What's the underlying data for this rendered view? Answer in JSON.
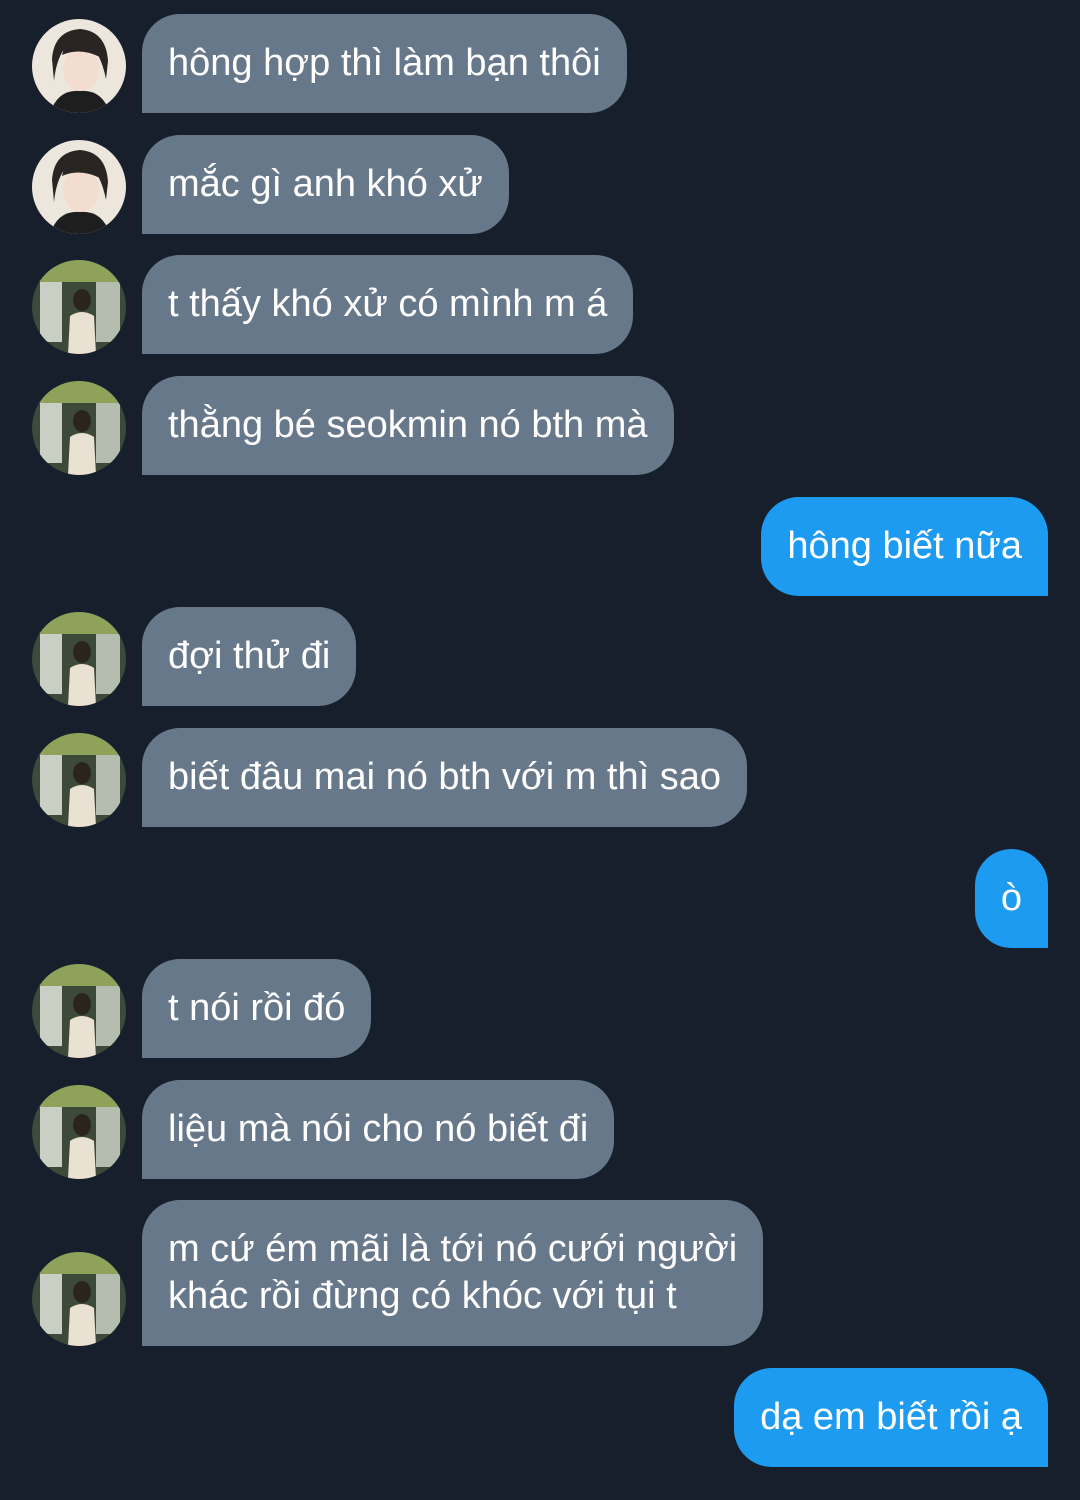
{
  "colors": {
    "background": "#161f2b",
    "incoming_bubble": "#67788a",
    "outgoing_bubble": "#1d9bf0",
    "text": "#ffffff"
  },
  "avatars": {
    "a": "portrait-avatar-light",
    "b": "photo-avatar-green"
  },
  "messages": [
    {
      "side": "in",
      "avatar": "a",
      "text": "hông hợp thì làm bạn thôi"
    },
    {
      "side": "in",
      "avatar": "a",
      "text": "mắc gì anh khó xử"
    },
    {
      "side": "in",
      "avatar": "b",
      "text": "t thấy khó xử có mình m á"
    },
    {
      "side": "in",
      "avatar": "b",
      "text": "thằng bé seokmin nó bth mà"
    },
    {
      "side": "out",
      "text": "hông biết nữa"
    },
    {
      "side": "in",
      "avatar": "b",
      "text": "đợi thử đi"
    },
    {
      "side": "in",
      "avatar": "b",
      "text": "biết đâu mai nó bth với m thì sao"
    },
    {
      "side": "out",
      "text": "ò"
    },
    {
      "side": "in",
      "avatar": "b",
      "text": "t nói rồi đó"
    },
    {
      "side": "in",
      "avatar": "b",
      "text": "liệu mà nói cho nó biết đi"
    },
    {
      "side": "in",
      "avatar": "b",
      "lines": [
        "m cứ ém mãi là tới nó cưới người",
        "khác rồi đừng có khóc với tụi t"
      ]
    },
    {
      "side": "out",
      "text": "dạ em biết rồi ạ"
    }
  ]
}
